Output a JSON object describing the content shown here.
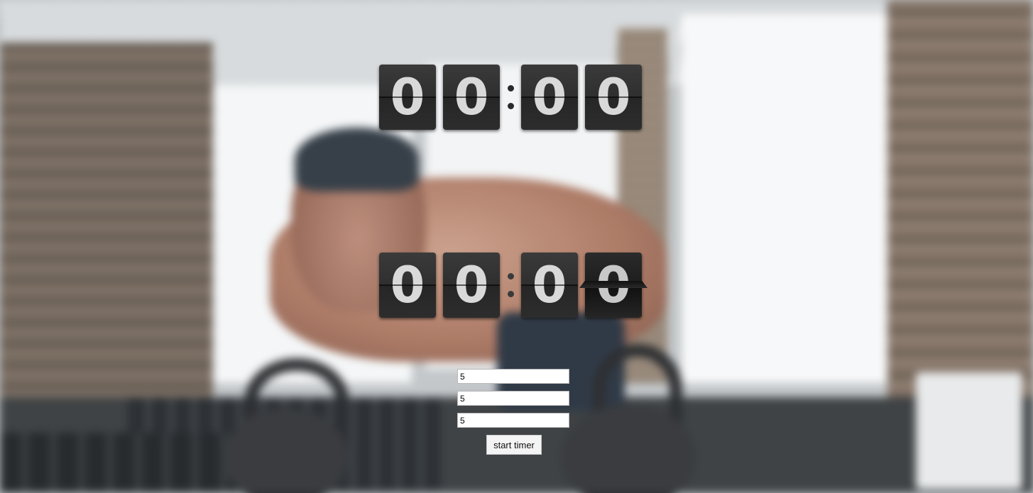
{
  "timer_display": {
    "digits": [
      "0",
      "0",
      "0",
      "0"
    ],
    "separator": ":"
  },
  "countdown_display": {
    "digits": [
      "0",
      "0",
      "0",
      "0"
    ],
    "separator": ":"
  },
  "inputs": [
    {
      "value": "5"
    },
    {
      "value": "5"
    },
    {
      "value": "5"
    }
  ],
  "start_button": {
    "label": "start timer"
  },
  "background": {
    "description_icon": "gym-photo-background"
  }
}
